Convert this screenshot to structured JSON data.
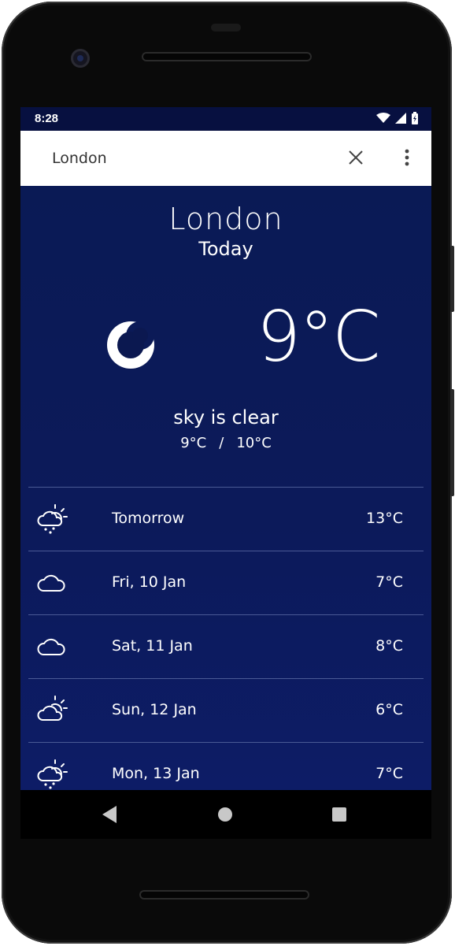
{
  "status_bar": {
    "time": "8:28",
    "icons": [
      "wifi-icon",
      "signal-icon",
      "battery-charging-icon"
    ]
  },
  "search": {
    "value": "London",
    "clear_icon": "close-icon",
    "menu_icon": "more-vert-icon"
  },
  "current": {
    "city": "London",
    "day": "Today",
    "icon": "moon-icon",
    "temperature": "9°C",
    "description": "sky is clear",
    "min": "9°C",
    "separator": "/",
    "max": "10°C"
  },
  "forecast": [
    {
      "icon": "sun-cloud-rain-icon",
      "date": "Tomorrow",
      "temp": "13°C"
    },
    {
      "icon": "cloud-icon",
      "date": "Fri, 10 Jan",
      "temp": "7°C"
    },
    {
      "icon": "cloud-icon",
      "date": "Sat, 11 Jan",
      "temp": "8°C"
    },
    {
      "icon": "sun-cloud-icon",
      "date": "Sun, 12 Jan",
      "temp": "6°C"
    },
    {
      "icon": "sun-cloud-rain-icon",
      "date": "Mon, 13 Jan",
      "temp": "7°C"
    }
  ],
  "nav": {
    "back_icon": "back-triangle-icon",
    "home_icon": "home-circle-icon",
    "recent_icon": "recent-square-icon"
  },
  "colors": {
    "background": "#0b1850",
    "status_bar": "#071040",
    "divider": "#4a5a95",
    "text": "#ffffff"
  }
}
